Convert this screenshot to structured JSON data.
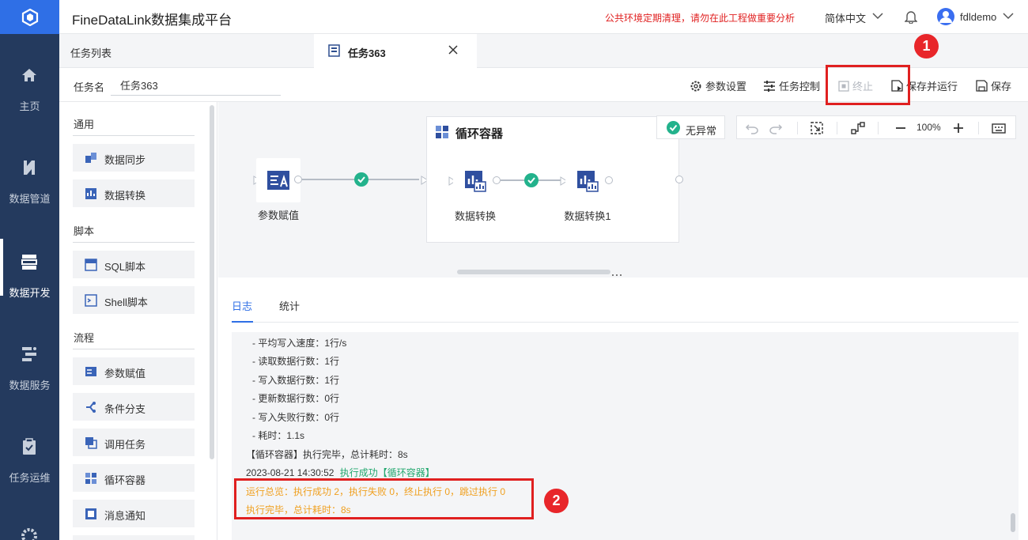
{
  "app": {
    "title": "FineDataLink数据集成平台",
    "notice": "公共环境定期清理，请勿在此工程做重要分析",
    "language": "简体中文",
    "username": "fdldemo",
    "brand_color": "#2f6fe6",
    "nav_bg": "#243a5e"
  },
  "nav": {
    "items": [
      {
        "label": "主页",
        "icon": "home-icon"
      },
      {
        "label": "数据管道",
        "icon": "pipeline-icon"
      },
      {
        "label": "数据开发",
        "icon": "data-dev-icon",
        "active": true
      },
      {
        "label": "数据服务",
        "icon": "data-service-icon"
      },
      {
        "label": "任务运维",
        "icon": "task-ops-icon"
      }
    ]
  },
  "tabs": {
    "list_label": "任务列表",
    "active_label": "任务363"
  },
  "task": {
    "name_label": "任务名",
    "name_value": "任务363"
  },
  "toolbar": {
    "params": "参数设置",
    "control": "任务控制",
    "stop": "终止",
    "save_run": "保存并运行",
    "save": "保存"
  },
  "palette": {
    "sections": [
      {
        "title": "通用",
        "items": [
          "数据同步",
          "数据转换"
        ]
      },
      {
        "title": "脚本",
        "items": [
          "SQL脚本",
          "Shell脚本"
        ]
      },
      {
        "title": "流程",
        "items": [
          "参数赋值",
          "条件分支",
          "调用任务",
          "循环容器",
          "消息通知"
        ]
      }
    ]
  },
  "canvas": {
    "container_title": "循环容器",
    "status": "无异常",
    "zoom": "100%",
    "nodes": {
      "param": "参数赋值",
      "transform": "数据转换",
      "transform1": "数据转换1"
    }
  },
  "log": {
    "tabs": [
      "日志",
      "统计"
    ],
    "lines": [
      "- 平均写入速度：1行/s",
      "- 读取数据行数：1行",
      "- 写入数据行数：1行",
      "- 更新数据行数：0行",
      "- 写入失败行数：0行",
      "- 耗时：1.1s",
      "【循环容器】执行完毕，总计耗时：8s"
    ],
    "success_time": "2023-08-21 14:30:52",
    "success_text": "执行成功【循环容器】",
    "summary1": "运行总览：执行成功 2，执行失败 0，终止执行 0，跳过执行 0",
    "summary2": "执行完毕，总计耗时：8s"
  },
  "annotations": {
    "badge1": "1",
    "badge2": "2",
    "highlight_color": "#e02020"
  }
}
